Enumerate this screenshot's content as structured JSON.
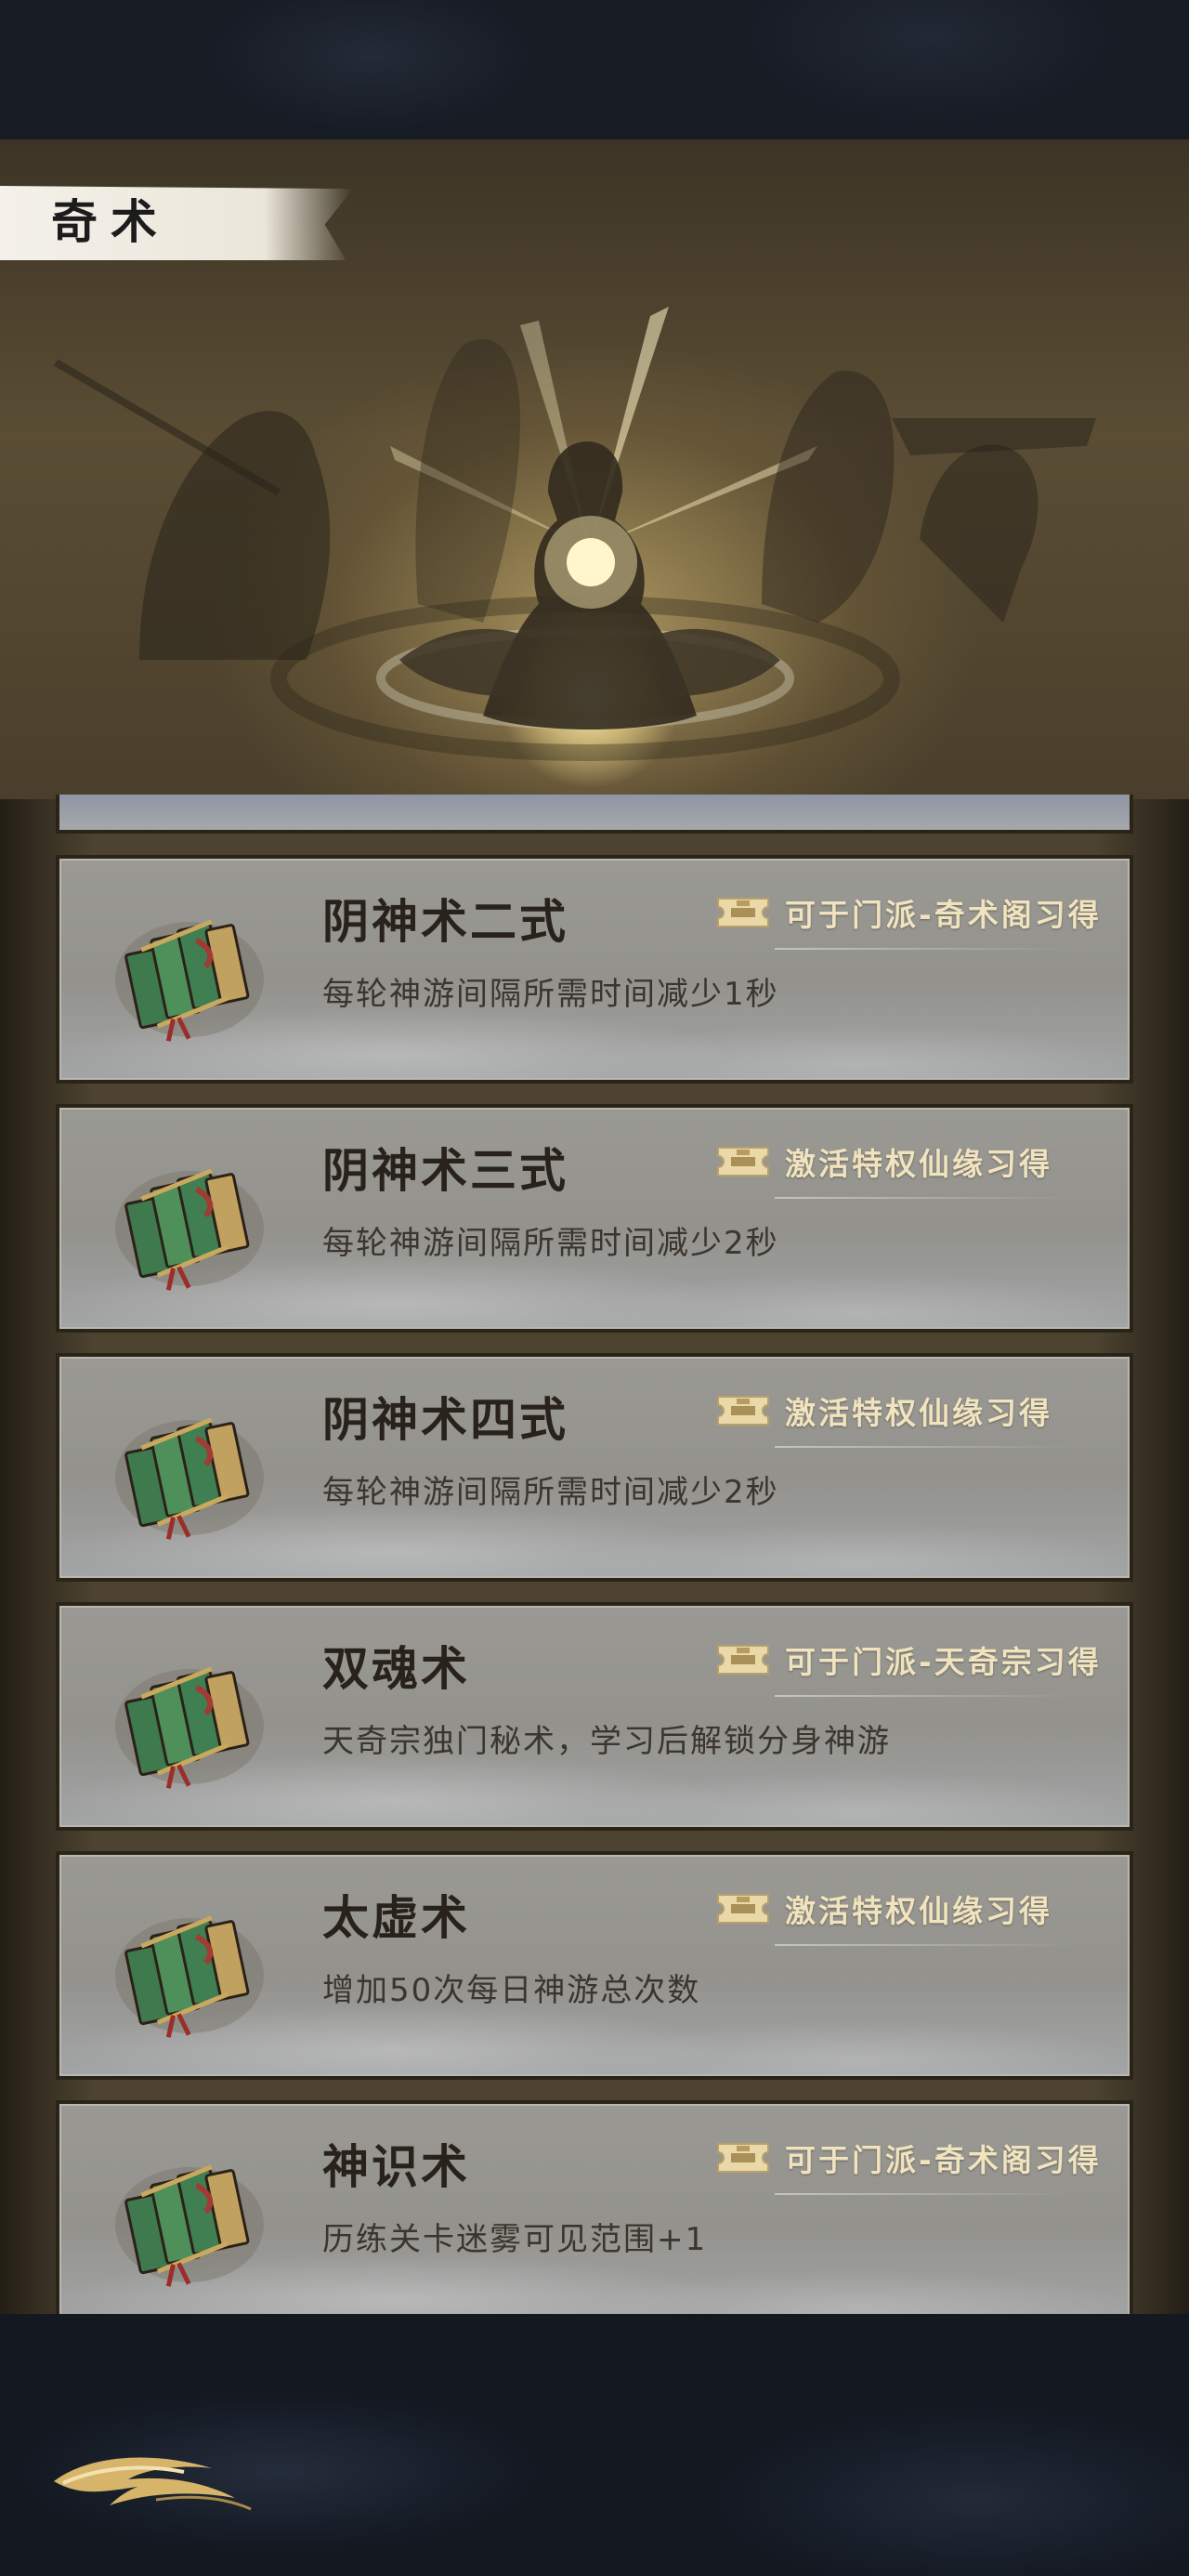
{
  "page": {
    "title": "奇术"
  },
  "skills": [
    {
      "name": "阴神术二式",
      "description": "每轮神游间隔所需时间减少1秒",
      "source": "可于门派-奇术阁习得"
    },
    {
      "name": "阴神术三式",
      "description": "每轮神游间隔所需时间减少2秒",
      "source": "激活特权仙缘习得"
    },
    {
      "name": "阴神术四式",
      "description": "每轮神游间隔所需时间减少2秒",
      "source": "激活特权仙缘习得"
    },
    {
      "name": "双魂术",
      "description": "天奇宗独门秘术，学习后解锁分身神游",
      "source": "可于门派-天奇宗习得"
    },
    {
      "name": "太虚术",
      "description": "增加50次每日神游总次数",
      "source": "激活特权仙缘习得"
    },
    {
      "name": "神识术",
      "description": "历练关卡迷雾可见范围+1",
      "source": "可于门派-奇术阁习得"
    }
  ],
  "icons": {
    "skill_icon": "scroll-book-icon",
    "source_icon": "ticket-icon",
    "back_icon": "ink-swirl-back-icon"
  },
  "colors": {
    "panel": "#4d4330",
    "card": "#9a9994",
    "source_text": "#f1e3bd",
    "title_text": "#1c1c1c"
  }
}
